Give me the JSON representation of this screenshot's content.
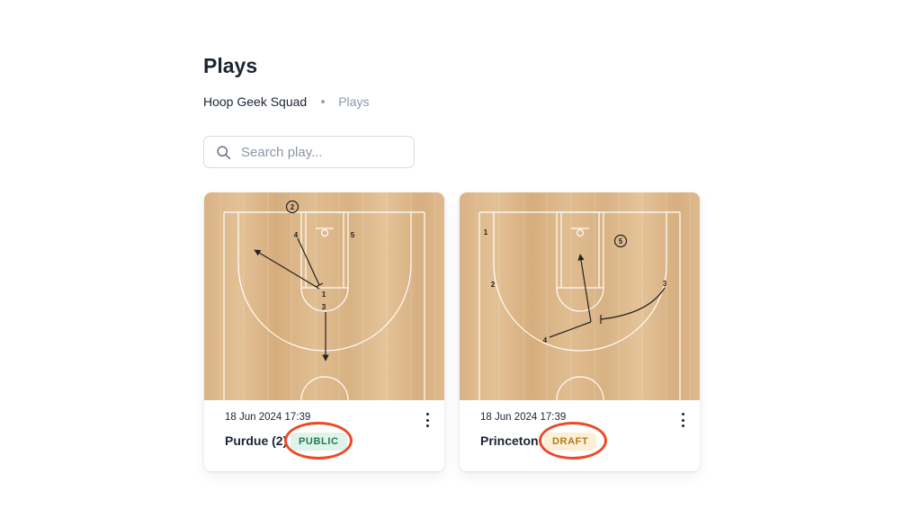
{
  "page": {
    "title": "Plays"
  },
  "breadcrumb": {
    "root": "Hoop Geek Squad",
    "current": "Plays"
  },
  "search": {
    "placeholder": "Search play...",
    "icon": "search-icon"
  },
  "plays": [
    {
      "date": "18 Jun 2024 17:39",
      "name": "Purdue (2)",
      "status": "PUBLIC",
      "menu_icon": "more-vertical-icon",
      "court_labels": [
        "2",
        "4",
        "5",
        "1",
        "3"
      ]
    },
    {
      "date": "18 Jun 2024 17:39",
      "name": "Princeton",
      "status": "DRAFT",
      "menu_icon": "more-vertical-icon",
      "court_labels": [
        "1",
        "5",
        "2",
        "3",
        "4"
      ]
    }
  ],
  "colors": {
    "court_wood": "#dfbb8d",
    "public_badge_bg": "#dff3ea",
    "public_badge_text": "#1d7a55",
    "draft_badge_bg": "#fbf0d6",
    "draft_badge_text": "#b57a16",
    "highlight_ring": "#ec4a26"
  }
}
